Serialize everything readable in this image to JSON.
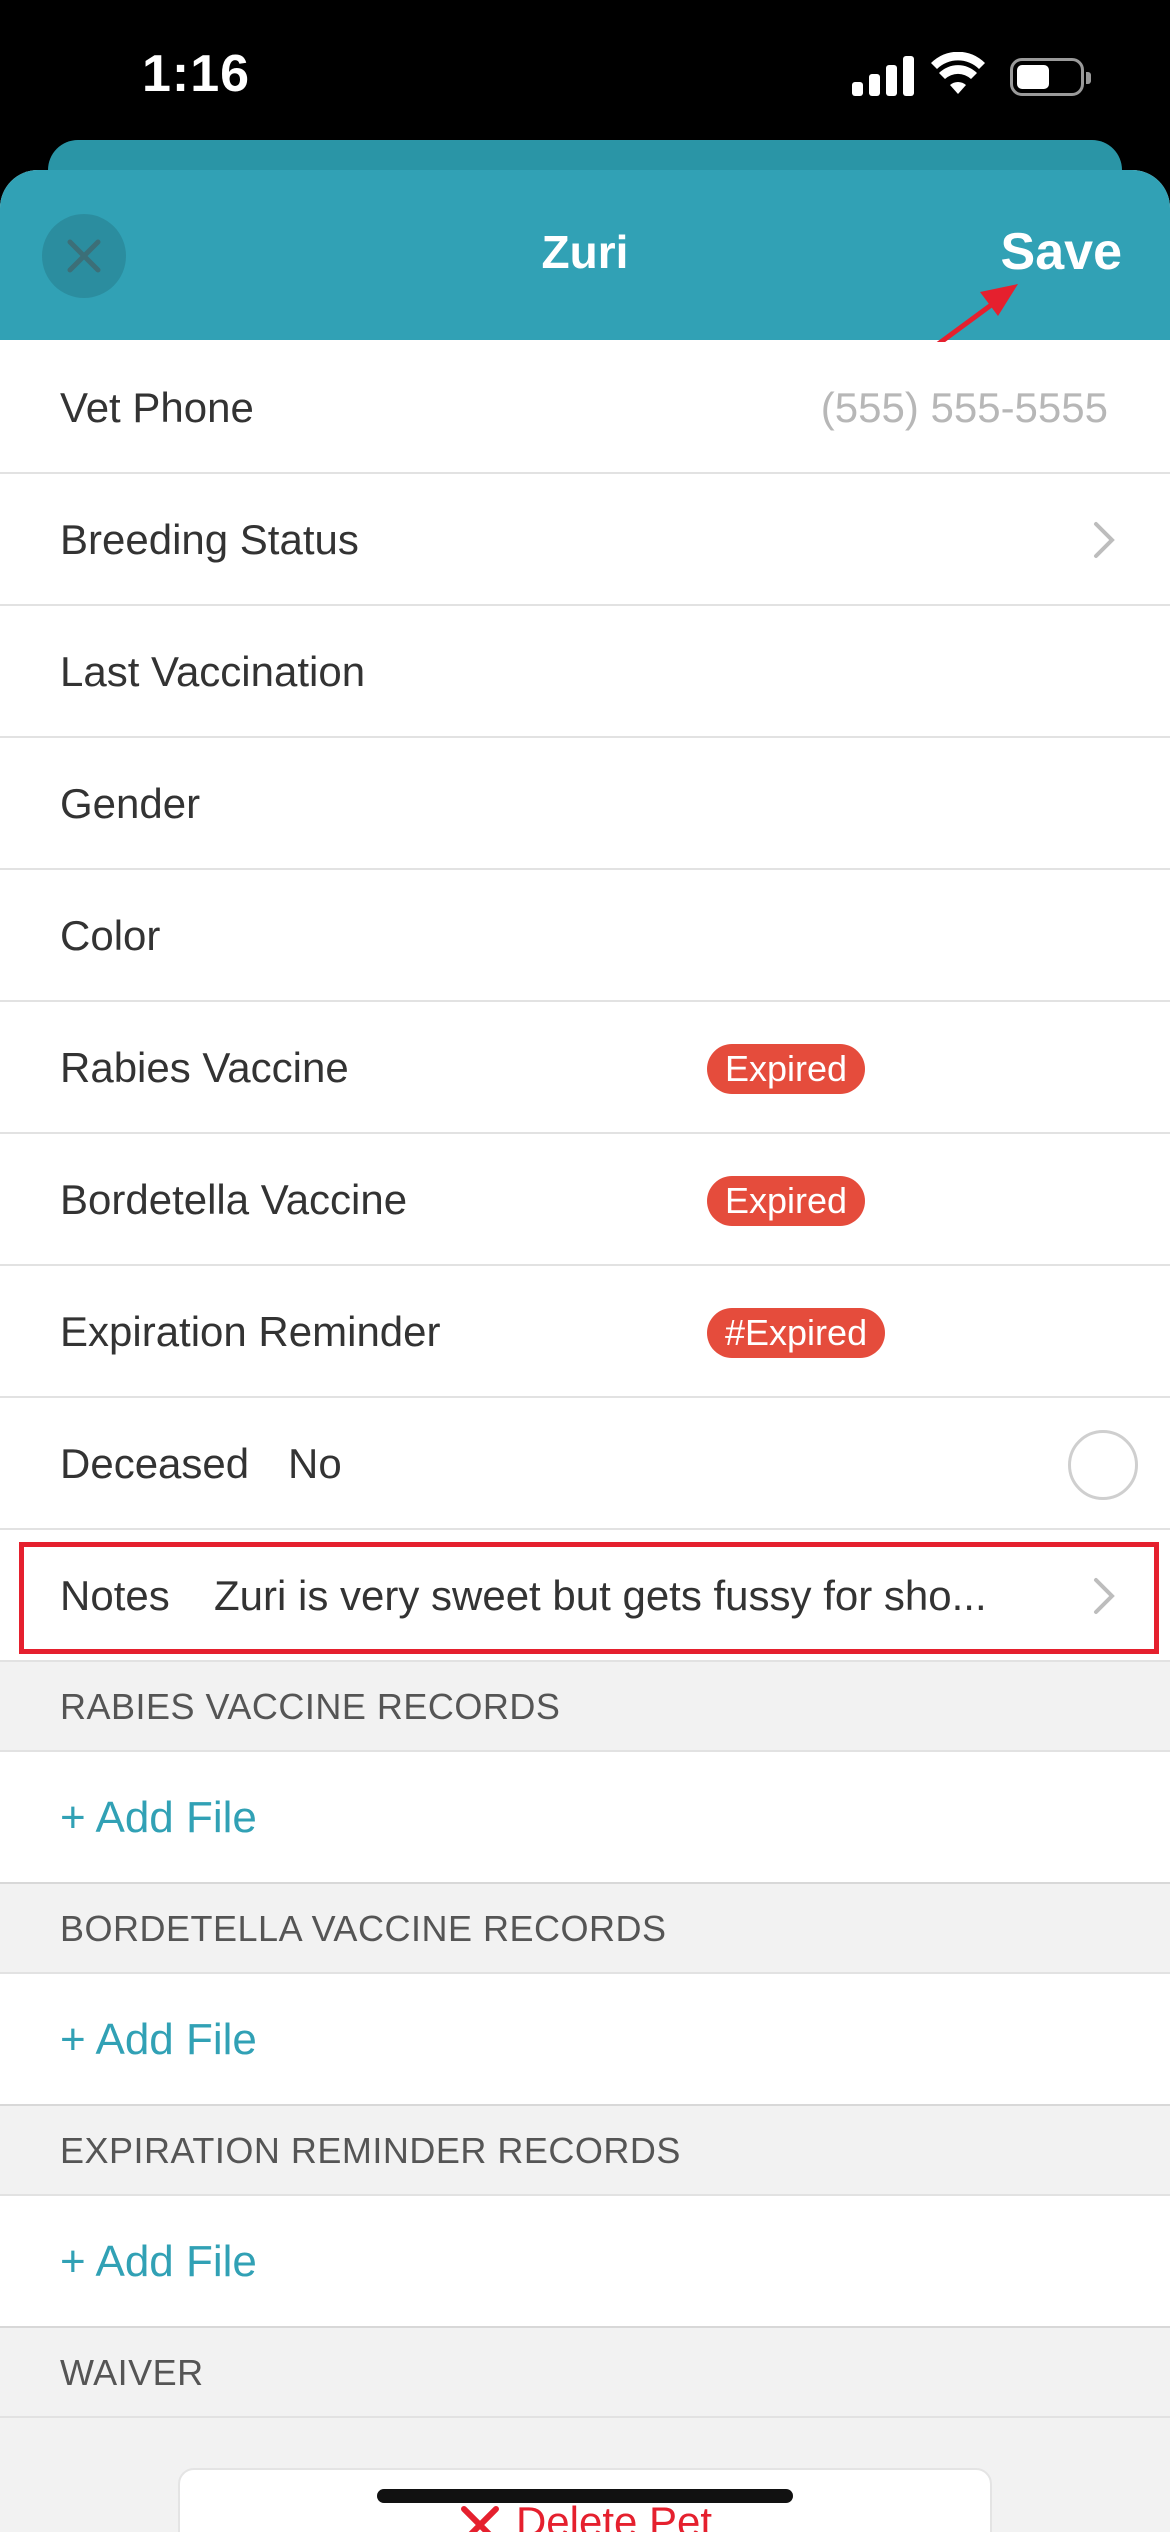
{
  "status_bar": {
    "time": "1:16"
  },
  "nav": {
    "title": "Zuri",
    "save_label": "Save",
    "close_icon": "close-icon"
  },
  "rows": {
    "vet_phone": {
      "label": "Vet Phone",
      "placeholder": "(555) 555-5555"
    },
    "breeding_status": {
      "label": "Breeding Status"
    },
    "last_vaccination": {
      "label": "Last Vaccination"
    },
    "gender": {
      "label": "Gender"
    },
    "color": {
      "label": "Color"
    },
    "rabies_vaccine": {
      "label": "Rabies Vaccine",
      "badge": "Expired"
    },
    "bordetella_vaccine": {
      "label": "Bordetella Vaccine",
      "badge": "Expired"
    },
    "expiration_reminder": {
      "label": "Expiration Reminder",
      "badge": "#Expired"
    },
    "deceased": {
      "label": "Deceased",
      "value": "No"
    },
    "notes": {
      "label": "Notes",
      "value": "Zuri is very sweet but gets fussy for sho..."
    }
  },
  "sections": {
    "rabies_records": {
      "header": "RABIES VACCINE RECORDS",
      "add_label": "+ Add File"
    },
    "bordetella_records": {
      "header": "BORDETELLA VACCINE RECORDS",
      "add_label": "+ Add File"
    },
    "expiration_records": {
      "header": "EXPIRATION REMINDER RECORDS",
      "add_label": "+ Add File"
    },
    "waiver": {
      "header": "WAIVER"
    }
  },
  "delete": {
    "label": "Delete Pet"
  },
  "colors": {
    "accent": "#31a1b5",
    "badge": "#e54c3c",
    "highlight": "#e5202e"
  }
}
